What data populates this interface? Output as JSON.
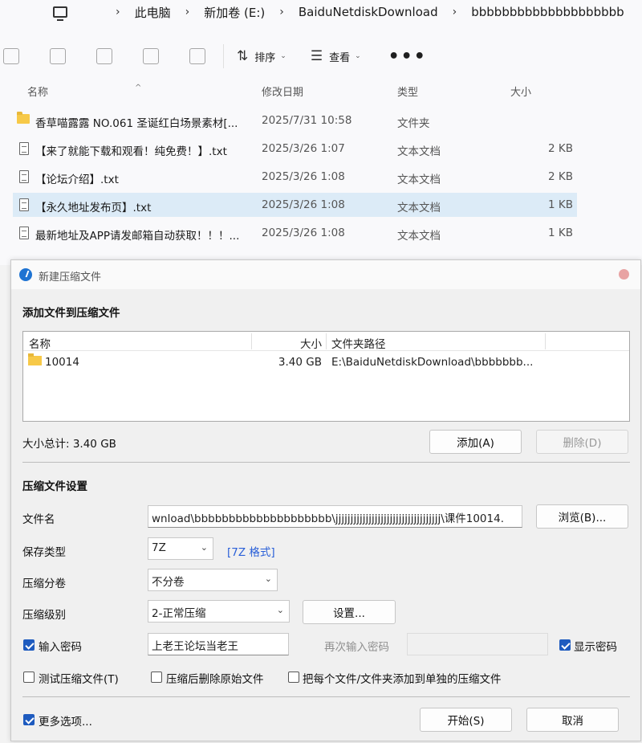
{
  "breadcrumb": [
    "此电脑",
    "新加卷 (E:)",
    "BaiduNetdiskDownload",
    "bbbbbbbbbbbbbbbbbbbb"
  ],
  "toolbar": {
    "sort_label": "排序",
    "view_label": "查看",
    "more_label": "•••"
  },
  "columns": {
    "name": "名称",
    "date": "修改日期",
    "type": "类型",
    "size": "大小"
  },
  "files": [
    {
      "name": "香草喵露露 NO.061 圣诞红白场景素材[...",
      "date": "2025/7/31 10:58",
      "type": "文件夹",
      "size": "",
      "kind": "folder"
    },
    {
      "name": "【来了就能下载和观看！纯免费！】.txt",
      "date": "2025/3/26 1:07",
      "type": "文本文档",
      "size": "2 KB",
      "kind": "doc"
    },
    {
      "name": "【论坛介绍】.txt",
      "date": "2025/3/26 1:08",
      "type": "文本文档",
      "size": "2 KB",
      "kind": "doc"
    },
    {
      "name": "【永久地址发布页】.txt",
      "date": "2025/3/26 1:08",
      "type": "文本文档",
      "size": "1 KB",
      "kind": "doc",
      "selected": true
    },
    {
      "name": "最新地址及APP请发邮箱自动获取！！！...",
      "date": "2025/3/26 1:08",
      "type": "文本文档",
      "size": "1 KB",
      "kind": "doc"
    }
  ],
  "dialog": {
    "title": "新建压缩文件",
    "add_section": "添加文件到压缩文件",
    "list_head": {
      "name": "名称",
      "size": "大小",
      "path": "文件夹路径"
    },
    "list_row": {
      "name": "10014",
      "size": "3.40 GB",
      "path": "E:\\BaiduNetdiskDownload\\bbbbbbb..."
    },
    "total_size": "大小总计: 3.40 GB",
    "add_button": "添加(A)",
    "delete_button": "删除(D)",
    "settings_section": "压缩文件设置",
    "filename_label": "文件名",
    "filename_value": "wnload\\bbbbbbbbbbbbbbbbbbbb\\jjjjjjjjjjjjjjjjjjjjjjjjjjjjjjjjjjj\\课件10014.",
    "browse_button": "浏览(B)...",
    "save_type_label": "保存类型",
    "save_type_value": "7Z",
    "format_link": "[7Z 格式]",
    "split_label": "压缩分卷",
    "split_value": "不分卷",
    "level_label": "压缩级别",
    "level_value": "2-正常压缩",
    "settings_button": "设置...",
    "password_label": "输入密码",
    "password_value": "上老王论坛当老王",
    "repeat_password_label": "再次输入密码",
    "show_password_label": "显示密码",
    "test_label": "测试压缩文件(T)",
    "delete_original_label": "压缩后删除原始文件",
    "separate_label": "把每个文件/文件夹添加到单独的压缩文件",
    "more_options_label": "更多选项...",
    "start_button": "开始(S)",
    "cancel_button": "取消"
  }
}
